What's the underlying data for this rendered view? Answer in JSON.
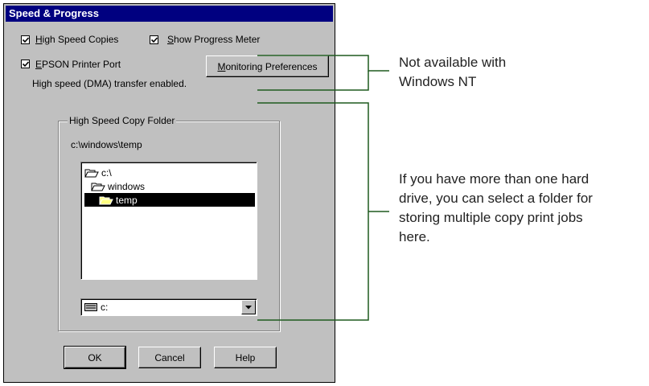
{
  "dialog": {
    "title": "Speed & Progress",
    "high_speed_copies": {
      "label_u": "H",
      "label_rest": "igh Speed Copies",
      "checked": true
    },
    "show_progress": {
      "label_u": "S",
      "label_rest": "how Progress Meter",
      "checked": true
    },
    "epson_port": {
      "label_u": "E",
      "label_rest": "PSON Printer Port",
      "checked": true
    },
    "monitoring_button": {
      "label_u": "M",
      "label_rest": "onitoring Preferences"
    },
    "dma_status": "High speed (DMA) transfer enabled.",
    "folder_group": {
      "title": "High Speed Copy Folder",
      "path": "c:\\windows\\temp",
      "folders": [
        {
          "name": "c:\\",
          "icon": "open-folder-icon",
          "selected": false
        },
        {
          "name": "windows",
          "icon": "open-folder-icon",
          "selected": false
        },
        {
          "name": "temp",
          "icon": "open-folder-icon",
          "selected": true
        }
      ],
      "drive": "c:",
      "drive_icon": "drive-icon"
    },
    "buttons": {
      "ok": "OK",
      "cancel": "Cancel",
      "help": "Help"
    }
  },
  "annotations": {
    "nt_note": [
      "Not available with",
      "Windows NT"
    ],
    "folder_note": [
      "If you have more than one hard",
      "drive, you can select a folder for",
      "storing multiple copy print jobs",
      "here."
    ]
  },
  "colors": {
    "titlebar": "#000080",
    "dialog_bg": "#c0c0c0",
    "callout_line": "#1f5a1f"
  }
}
